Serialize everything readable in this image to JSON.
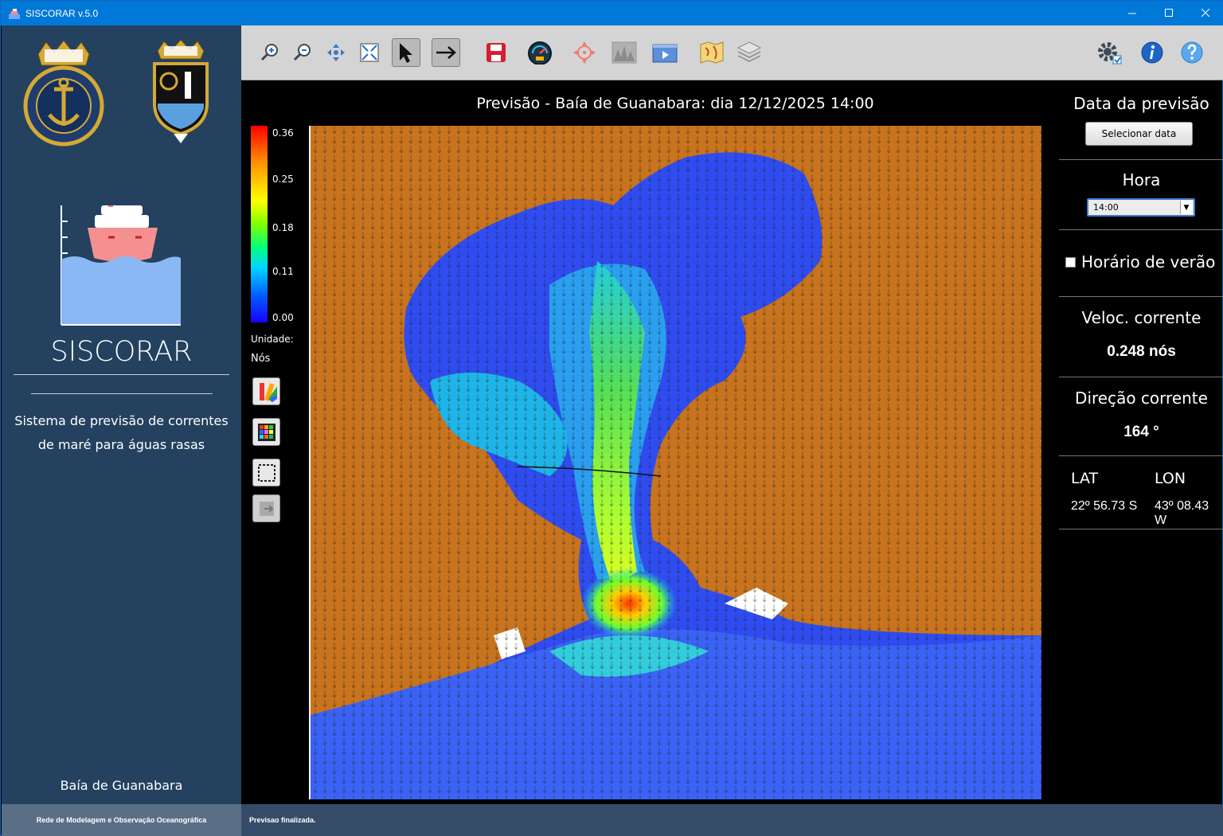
{
  "window": {
    "title": "SISCORAR v.5.0"
  },
  "sidebar": {
    "app_name": "SISCORAR",
    "description_line1": "Sistema de previsão de correntes",
    "description_line2": "de maré para águas rasas",
    "region": "Baía de Guanabara",
    "emblems": [
      "marinha-do-brasil-emblem",
      "dhn-emblem"
    ]
  },
  "toolbar": {
    "buttons": [
      "zoom-in-icon",
      "zoom-out-icon",
      "pan-icon",
      "fit-extent-icon",
      "pointer-icon",
      "arrow-tool-icon",
      "save-icon",
      "gauge-icon",
      "target-icon",
      "chart-icon",
      "animation-icon",
      "map-icon",
      "layers-icon",
      "settings-icon",
      "info-icon",
      "help-icon"
    ],
    "selected": [
      "pointer-icon"
    ]
  },
  "map": {
    "title": "Previsão - Baía de Guanabara: dia 12/12/2025 14:00",
    "colorbar_ticks": [
      "0.36",
      "0.25",
      "0.18",
      "0.11",
      "0.00"
    ],
    "unit_label": "Unidade:",
    "unit_value": "Nós",
    "land_color": "#c8731d",
    "side_tools": [
      "palette-icon",
      "color-grid-icon",
      "select-area-icon",
      "export-icon"
    ]
  },
  "panel": {
    "date_heading": "Data da previsão",
    "date_button": "Selecionar data",
    "hour_heading": "Hora",
    "hour_value": "14:00",
    "dst_label": "Horário de verão",
    "dst_checked": false,
    "speed_heading": "Veloc. corrente",
    "speed_value": "0.248 nós",
    "direction_heading": "Direção corrente",
    "direction_value": "164 °",
    "lat_label": "LAT",
    "lon_label": "LON",
    "lat_value": "22º 56.73 S",
    "lon_value": "43º 08.43 W"
  },
  "status": {
    "left": "Rede de Modelagem e Observação Oceanográfica",
    "message": "Previsao finalizada."
  }
}
